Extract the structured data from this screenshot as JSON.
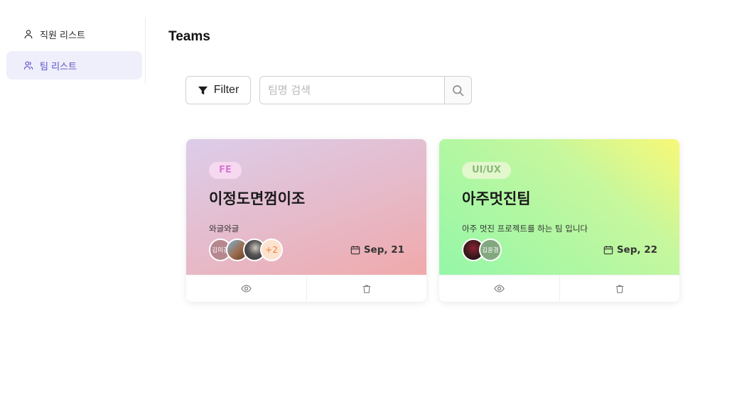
{
  "sidebar": {
    "items": [
      {
        "label": "직원 리스트",
        "icon": "user-icon",
        "active": false
      },
      {
        "label": "팀 리스트",
        "icon": "team-icon",
        "active": true
      }
    ]
  },
  "page": {
    "title": "Teams"
  },
  "toolbar": {
    "filter_label": "Filter",
    "search_placeholder": "팀명 검색",
    "search_value": ""
  },
  "teams": [
    {
      "tag": "FE",
      "name": "이정도면껌이조",
      "description": "와글와글",
      "members": [
        {
          "label": "김미경",
          "color": "#b7878f"
        },
        {
          "label": "",
          "color": "#9c6a4a"
        },
        {
          "label": "",
          "color": "#3d3d44"
        }
      ],
      "more_count": "+2",
      "date": "Sep, 21"
    },
    {
      "tag": "UI/UX",
      "name": "아주멋진팀",
      "description": "아주 멋진 프로젝트를 하는 팀 입니다",
      "members": [
        {
          "label": "",
          "color": "#3b1a1e"
        },
        {
          "label": "김윤경",
          "color": "#82a880"
        }
      ],
      "more_count": "",
      "date": "Sep, 22"
    }
  ],
  "colors": {
    "accent": "#5b52c9",
    "active_bg": "#efeefb"
  }
}
